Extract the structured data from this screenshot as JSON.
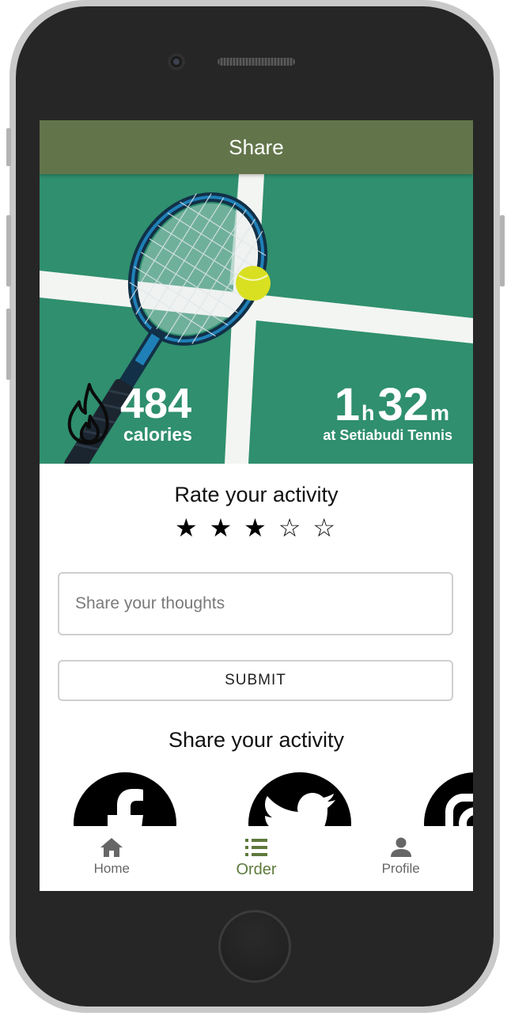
{
  "header": {
    "title": "Share"
  },
  "hero": {
    "calories_value": "484",
    "calories_label": "calories",
    "duration_hours": "1",
    "hours_unit": "h",
    "duration_minutes": "32",
    "minutes_unit": "m",
    "location": "at Setiabudi Tennis"
  },
  "rating": {
    "title": "Rate your activity",
    "value": 3,
    "max": 5,
    "stars": [
      "★",
      "★",
      "★",
      "☆",
      "☆"
    ]
  },
  "thoughts": {
    "placeholder": "Share your thoughts",
    "value": ""
  },
  "submit": {
    "label": "SUBMIT"
  },
  "share": {
    "title": "Share your activity",
    "icons": [
      "facebook-icon",
      "twitter-icon",
      "instagram-icon"
    ]
  },
  "nav": {
    "items": [
      {
        "label": "Home",
        "icon": "home-icon"
      },
      {
        "label": "Order",
        "icon": "list-icon"
      },
      {
        "label": "Profile",
        "icon": "person-icon"
      }
    ],
    "active": "Order"
  },
  "colors": {
    "header": "#62754a",
    "active_nav": "#5d7a3c",
    "court": "#2f8f6e"
  }
}
